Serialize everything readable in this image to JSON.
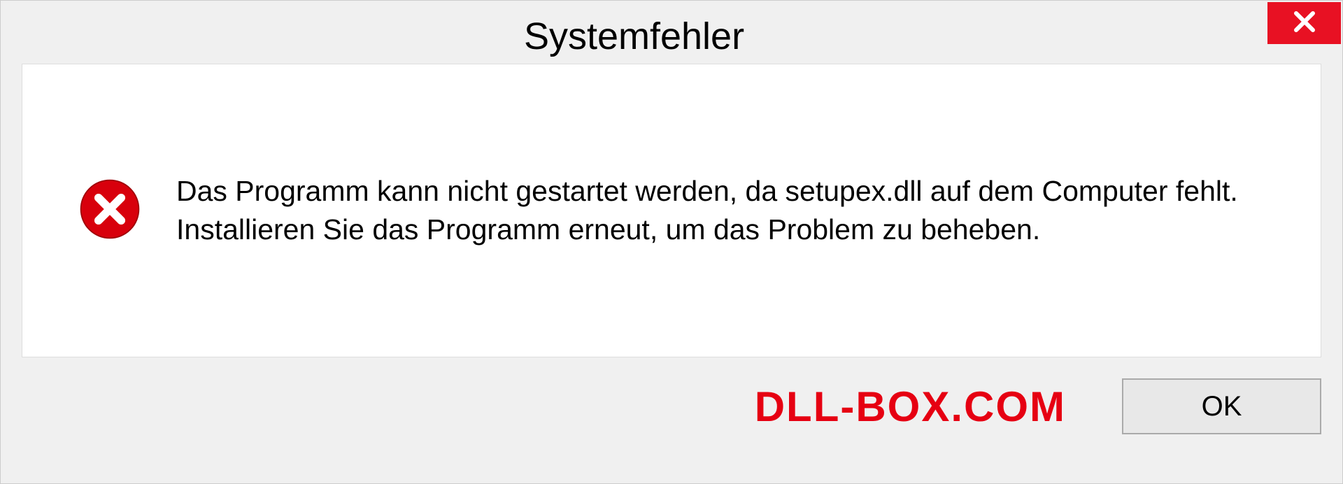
{
  "dialog": {
    "title": "Systemfehler",
    "message": "Das Programm kann nicht gestartet werden, da setupex.dll auf dem Computer fehlt. Installieren Sie das Programm erneut, um das Problem zu beheben.",
    "ok_label": "OK"
  },
  "watermark": "DLL-BOX.COM",
  "colors": {
    "close_red": "#e81123",
    "error_red": "#d8000c",
    "watermark_red": "#e60012"
  }
}
